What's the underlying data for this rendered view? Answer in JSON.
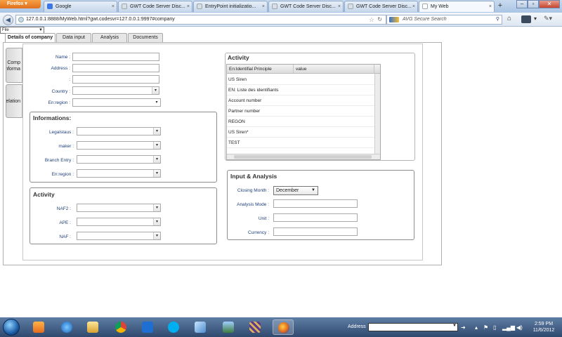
{
  "browser": {
    "app_button": "Firefox",
    "tabs": [
      {
        "label": "Google",
        "favicon_color": "#3b78e7"
      },
      {
        "label": "GWT Code Server Disc...",
        "favicon_color": "#d8dde6"
      },
      {
        "label": "EntryPoint initializatio...",
        "favicon_color": "#d8dde6"
      },
      {
        "label": "GWT Code Server Disc...",
        "favicon_color": "#d8dde6"
      },
      {
        "label": "GWT Code Server Disc...",
        "favicon_color": "#d8dde6"
      },
      {
        "label": "My Web",
        "favicon_color": "#d8dde6"
      }
    ],
    "new_tab": "+",
    "url": "127.0.0.1:8888/MyWeb.html?gwt.codesvr=127.0.0.1:9997#company",
    "search_placeholder": "AVG Secure Search"
  },
  "page": {
    "file_select": "File",
    "tabs": [
      "Details of company",
      "Data input",
      "Analysis",
      "Documents"
    ],
    "side_tabs": [
      {
        "line1": "Comp",
        "line2": "Informa"
      },
      {
        "line1": "Relation",
        "line2": ""
      }
    ],
    "basic": {
      "name_label": "Name :",
      "address_label": "Address :",
      "address2_label": ":",
      "country_label": "Country :",
      "enregion_label": "En:region :"
    },
    "informations": {
      "title": "Informations:",
      "fields": [
        "Legalstaus :",
        "maker :",
        "Branch Entry :",
        "En:region :"
      ]
    },
    "activity_left": {
      "title": "Activity",
      "fields": [
        "NAF2 :",
        "APE :",
        "NAF :"
      ]
    },
    "activity_right": {
      "title": "Activity",
      "columns": [
        "En:Identifial Principle",
        "value"
      ],
      "rows": [
        "US Siren",
        "EN: Liste des identifiants",
        "Account number",
        "Partner number",
        "REGON",
        "US Siren*",
        "TEST"
      ]
    },
    "input_analysis": {
      "title": "Input & Analysis",
      "closing_month_label": "Closing Month :",
      "closing_month_value": "December",
      "analysis_mode_label": "Analysis Mode :",
      "unit_label": "Unit :",
      "currency_label": "Currency :"
    }
  },
  "taskbar": {
    "address_label": "Address",
    "time": "2:59 PM",
    "date": "11/6/2012"
  }
}
